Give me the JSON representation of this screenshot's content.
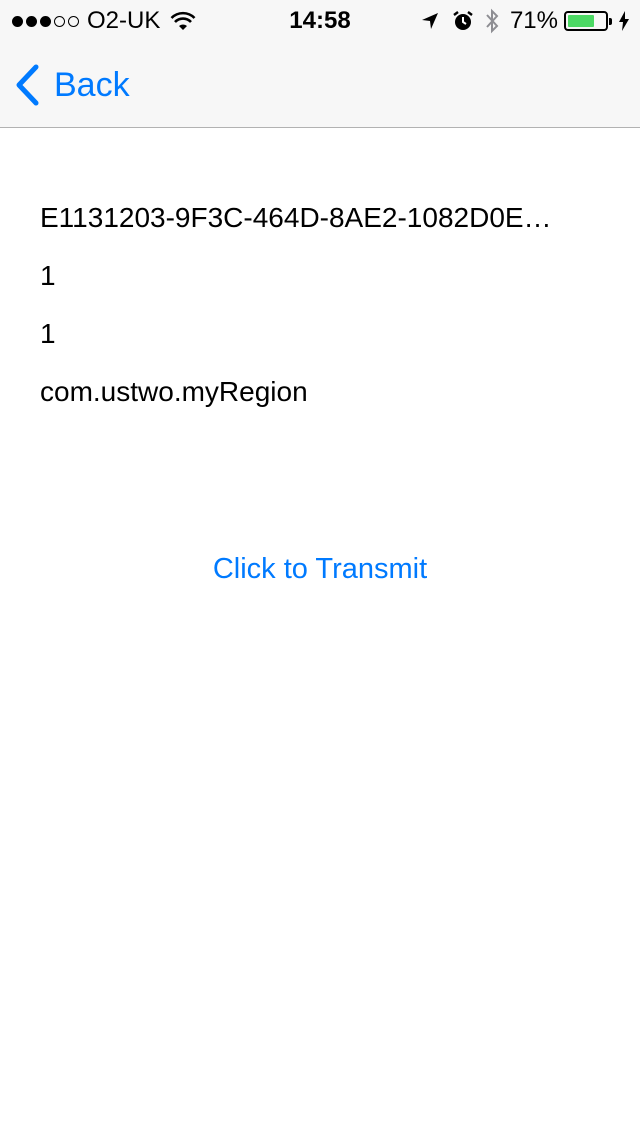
{
  "status_bar": {
    "carrier": "O2-UK",
    "time": "14:58",
    "battery_percent": "71%",
    "battery_level": 0.71,
    "signal_strength": 3,
    "signal_max": 5
  },
  "nav": {
    "back_label": "Back"
  },
  "beacon": {
    "uuid": "E1131203-9F3C-464D-8AE2-1082D0E…",
    "major": "1",
    "minor": "1",
    "identifier": "com.ustwo.myRegion"
  },
  "actions": {
    "transmit_label": "Click to Transmit"
  },
  "colors": {
    "accent": "#007aff",
    "battery_fill": "#4cd964",
    "bar_background": "#f7f7f7"
  }
}
